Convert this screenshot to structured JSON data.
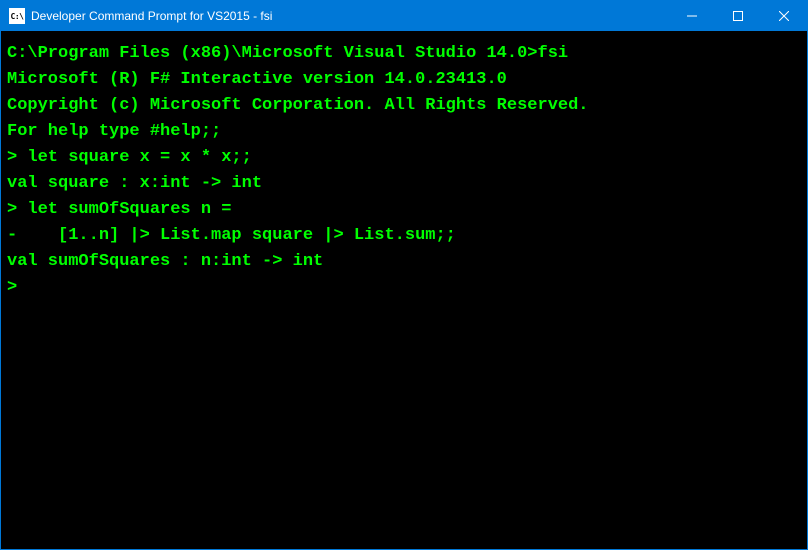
{
  "titlebar": {
    "icon_text": "C:\\",
    "title": "Developer Command Prompt for VS2015 - fsi"
  },
  "terminal": {
    "line_blank1": "",
    "line_prompt": "C:\\Program Files (x86)\\Microsoft Visual Studio 14.0>fsi",
    "line_blank2": "",
    "line_header1": "Microsoft (R) F# Interactive version 14.0.23413.0",
    "line_header2": "Copyright (c) Microsoft Corporation. All Rights Reserved.",
    "line_blank3": "",
    "line_help": "For help type #help;;",
    "line_blank4": "",
    "line_input1": "> let square x = x * x;;",
    "line_blank5": "",
    "line_val1": "val square : x:int -> int",
    "line_blank6": "",
    "line_input2a": "> let sumOfSquares n =",
    "line_input2b": "-    [1..n] |> List.map square |> List.sum;;",
    "line_blank7": "",
    "line_val2": "val sumOfSquares : n:int -> int",
    "line_blank8": "",
    "line_cursor": ">"
  }
}
